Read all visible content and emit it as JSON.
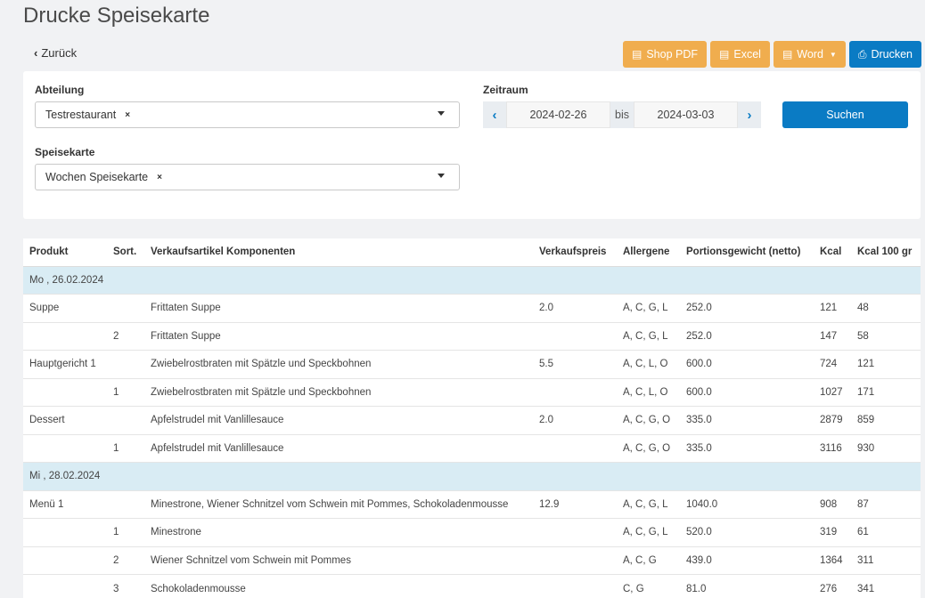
{
  "page": {
    "title": "Drucke Speisekarte",
    "back_label": "Zurück"
  },
  "toolbar": {
    "shop_pdf": "Shop PDF",
    "excel": "Excel",
    "word": "Word",
    "print": "Drucken",
    "colors": {
      "orange": "#f0ad4e",
      "blue": "#0a7bc4"
    }
  },
  "filters": {
    "abteilung_label": "Abteilung",
    "abteilung_value": "Testrestaurant",
    "speisekarte_label": "Speisekarte",
    "speisekarte_value": "Wochen Speisekarte",
    "zeitraum_label": "Zeitraum",
    "date_from": "2024-02-26",
    "bis_label": "bis",
    "date_to": "2024-03-03",
    "search_label": "Suchen",
    "clear_glyph": "×"
  },
  "table": {
    "headers": {
      "produkt": "Produkt",
      "sort": "Sort.",
      "komponenten": "Verkaufsartikel Komponenten",
      "preis": "Verkaufspreis",
      "allergene": "Allergene",
      "gewicht": "Portionsgewicht (netto)",
      "kcal": "Kcal",
      "kcal100": "Kcal 100 gr"
    },
    "rows": [
      {
        "type": "day",
        "label": "Mo , 26.02.2024"
      },
      {
        "type": "item",
        "produkt": "Suppe",
        "sort": "",
        "komponenten": "Frittaten Suppe",
        "preis": "2.0",
        "allergene": "A, C, G, L",
        "gewicht": "252.0",
        "kcal": "121",
        "kcal100": "48"
      },
      {
        "type": "item",
        "produkt": "",
        "sort": "2",
        "komponenten": "Frittaten Suppe",
        "preis": "",
        "allergene": "A, C, G, L",
        "gewicht": "252.0",
        "kcal": "147",
        "kcal100": "58"
      },
      {
        "type": "item",
        "produkt": "Hauptgericht 1",
        "sort": "",
        "komponenten": "Zwiebelrostbraten mit Spätzle und Speckbohnen",
        "preis": "5.5",
        "allergene": "A, C, L, O",
        "gewicht": "600.0",
        "kcal": "724",
        "kcal100": "121"
      },
      {
        "type": "item",
        "produkt": "",
        "sort": "1",
        "komponenten": "Zwiebelrostbraten mit Spätzle und Speckbohnen",
        "preis": "",
        "allergene": "A, C, L, O",
        "gewicht": "600.0",
        "kcal": "1027",
        "kcal100": "171"
      },
      {
        "type": "item",
        "produkt": "Dessert",
        "sort": "",
        "komponenten": "Apfelstrudel mit Vanlillesauce",
        "preis": "2.0",
        "allergene": "A, C, G, O",
        "gewicht": "335.0",
        "kcal": "2879",
        "kcal100": "859"
      },
      {
        "type": "item",
        "produkt": "",
        "sort": "1",
        "komponenten": "Apfelstrudel mit Vanlillesauce",
        "preis": "",
        "allergene": "A, C, G, O",
        "gewicht": "335.0",
        "kcal": "3116",
        "kcal100": "930"
      },
      {
        "type": "day",
        "label": "Mi , 28.02.2024"
      },
      {
        "type": "item",
        "produkt": "Menü 1",
        "sort": "",
        "komponenten": "Minestrone, Wiener Schnitzel vom Schwein mit Pommes, Schokoladenmousse",
        "preis": "12.9",
        "allergene": "A, C, G, L",
        "gewicht": "1040.0",
        "kcal": "908",
        "kcal100": "87"
      },
      {
        "type": "item",
        "produkt": "",
        "sort": "1",
        "komponenten": "Minestrone",
        "preis": "",
        "allergene": "A, C, G, L",
        "gewicht": "520.0",
        "kcal": "319",
        "kcal100": "61"
      },
      {
        "type": "item",
        "produkt": "",
        "sort": "2",
        "komponenten": "Wiener Schnitzel vom Schwein mit Pommes",
        "preis": "",
        "allergene": "A, C, G",
        "gewicht": "439.0",
        "kcal": "1364",
        "kcal100": "311"
      },
      {
        "type": "item",
        "produkt": "",
        "sort": "3",
        "komponenten": "Schokoladenmousse",
        "preis": "",
        "allergene": "C, G",
        "gewicht": "81.0",
        "kcal": "276",
        "kcal100": "341"
      }
    ]
  }
}
